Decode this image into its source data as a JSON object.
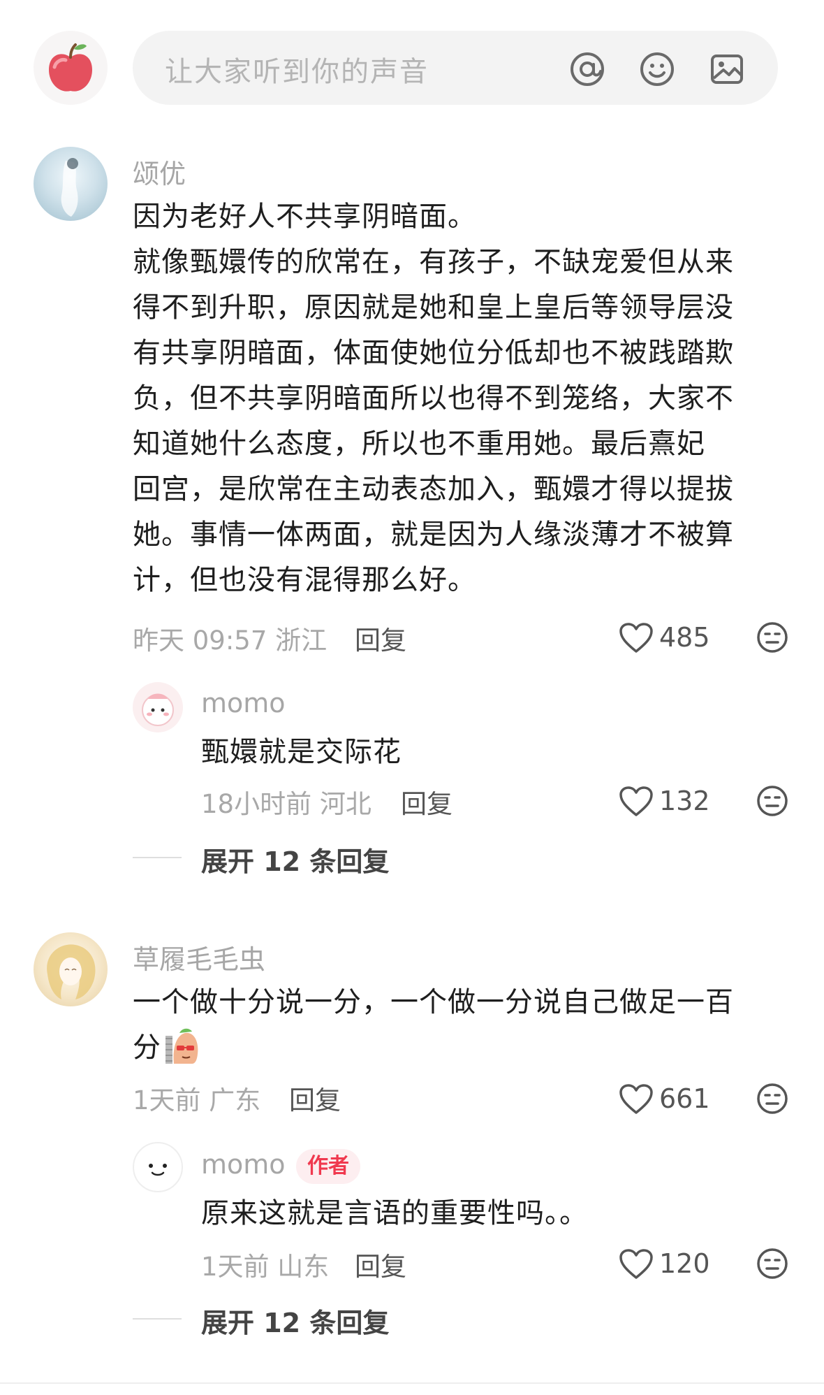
{
  "input_bar": {
    "placeholder": "让大家听到你的声音"
  },
  "comments": [
    {
      "username": "颂优",
      "text": "因为老好人不共享阴暗面。\n就像甄嬛传的欣常在，有孩子，不缺宠爱但从来\n得不到升职，原因就是她和皇上皇后等领导层没\n有共享阴暗面，体面使她位分低却也不被践踏欺\n负，但不共享阴暗面所以也得不到笼络，大家不\n知道她什么态度，所以也不重用她。最后熹妃\n回宫，是欣常在主动表态加入，甄嬛才得以提拔\n她。事情一体两面，就是因为人缘淡薄才不被算\n计，但也没有混得那么好。",
      "meta": "昨天 09:57 浙江",
      "reply_label": "回复",
      "likes": "485",
      "replies": [
        {
          "username": "momo",
          "text": "甄嬛就是交际花",
          "meta": "18小时前 河北",
          "reply_label": "回复",
          "likes": "132"
        }
      ],
      "expand_label": "展开 12 条回复"
    },
    {
      "username": "草履毛毛虫",
      "text": "一个做十分说一分，一个做一分说自己做足一百\n分",
      "meta": "1天前 广东",
      "reply_label": "回复",
      "likes": "661",
      "replies": [
        {
          "username": "momo",
          "badge": "作者",
          "text": "原来这就是言语的重要性吗。。",
          "meta": "1天前 山东",
          "reply_label": "回复",
          "likes": "120"
        }
      ],
      "expand_label": "展开 12 条回复"
    }
  ],
  "colors": {
    "author_badge": "#f0394f",
    "muted_text": "#a6a6a6"
  },
  "icons": [
    "at-icon",
    "emoji-icon",
    "image-icon",
    "heart-icon",
    "dislike-face-icon",
    "apple-icon"
  ]
}
